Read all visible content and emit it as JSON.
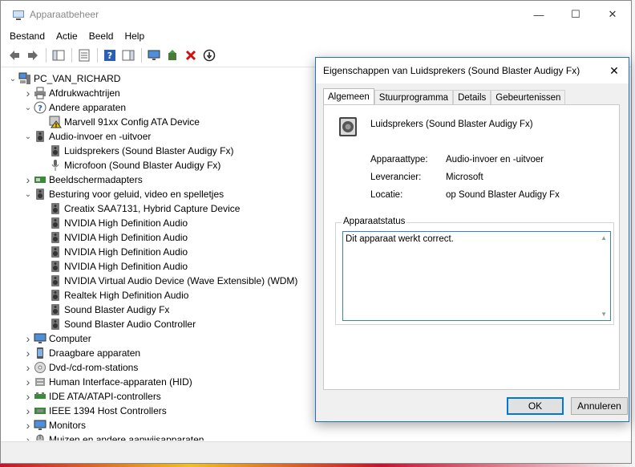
{
  "window": {
    "title": "Apparaatbeheer",
    "minimize_icon": "minimize-icon",
    "maximize_icon": "maximize-icon",
    "close_icon": "close-icon"
  },
  "menu": [
    "Bestand",
    "Actie",
    "Beeld",
    "Help"
  ],
  "toolbar": [
    "back-icon",
    "forward-icon",
    "show-hide-console-tree-icon",
    "properties-icon",
    "help-icon",
    "action-pane-icon",
    "monitor-icon",
    "update-driver-icon",
    "uninstall-icon",
    "disable-icon"
  ],
  "tree": [
    {
      "label": "PC_VAN_RICHARD",
      "level": 0,
      "expander": "expanded",
      "icon": "computer-icon"
    },
    {
      "label": "Afdrukwachtrijen",
      "level": 1,
      "expander": "collapsed",
      "icon": "printer-icon"
    },
    {
      "label": "Andere apparaten",
      "level": 1,
      "expander": "expanded",
      "icon": "unknown-device-icon"
    },
    {
      "label": "Marvell 91xx Config ATA Device",
      "level": 2,
      "expander": "none",
      "icon": "warning-device-icon"
    },
    {
      "label": "Audio-invoer en -uitvoer",
      "level": 1,
      "expander": "expanded",
      "icon": "speaker-icon"
    },
    {
      "label": "Luidsprekers (Sound Blaster Audigy Fx)",
      "level": 2,
      "expander": "none",
      "icon": "speaker-icon"
    },
    {
      "label": "Microfoon (Sound Blaster Audigy Fx)",
      "level": 2,
      "expander": "none",
      "icon": "microphone-icon"
    },
    {
      "label": "Beeldschermadapters",
      "level": 1,
      "expander": "collapsed",
      "icon": "display-adapter-icon"
    },
    {
      "label": "Besturing voor geluid, video en spelletjes",
      "level": 1,
      "expander": "expanded",
      "icon": "speaker-icon"
    },
    {
      "label": "Creatix SAA7131, Hybrid Capture Device",
      "level": 2,
      "expander": "none",
      "icon": "speaker-icon"
    },
    {
      "label": "NVIDIA High Definition Audio",
      "level": 2,
      "expander": "none",
      "icon": "speaker-icon"
    },
    {
      "label": "NVIDIA High Definition Audio",
      "level": 2,
      "expander": "none",
      "icon": "speaker-icon"
    },
    {
      "label": "NVIDIA High Definition Audio",
      "level": 2,
      "expander": "none",
      "icon": "speaker-icon"
    },
    {
      "label": "NVIDIA High Definition Audio",
      "level": 2,
      "expander": "none",
      "icon": "speaker-icon"
    },
    {
      "label": "NVIDIA Virtual Audio Device (Wave Extensible) (WDM)",
      "level": 2,
      "expander": "none",
      "icon": "speaker-icon"
    },
    {
      "label": "Realtek High Definition Audio",
      "level": 2,
      "expander": "none",
      "icon": "speaker-icon"
    },
    {
      "label": "Sound Blaster Audigy Fx",
      "level": 2,
      "expander": "none",
      "icon": "speaker-icon"
    },
    {
      "label": "Sound Blaster Audio Controller",
      "level": 2,
      "expander": "none",
      "icon": "speaker-icon"
    },
    {
      "label": "Computer",
      "level": 1,
      "expander": "collapsed",
      "icon": "monitor-icon"
    },
    {
      "label": "Draagbare apparaten",
      "level": 1,
      "expander": "collapsed",
      "icon": "portable-device-icon"
    },
    {
      "label": "Dvd-/cd-rom-stations",
      "level": 1,
      "expander": "collapsed",
      "icon": "disc-drive-icon"
    },
    {
      "label": "Human Interface-apparaten (HID)",
      "level": 1,
      "expander": "collapsed",
      "icon": "hid-icon"
    },
    {
      "label": "IDE ATA/ATAPI-controllers",
      "level": 1,
      "expander": "collapsed",
      "icon": "ide-controller-icon"
    },
    {
      "label": "IEEE 1394 Host Controllers",
      "level": 1,
      "expander": "collapsed",
      "icon": "ieee1394-icon"
    },
    {
      "label": "Monitors",
      "level": 1,
      "expander": "collapsed",
      "icon": "monitor-icon"
    },
    {
      "label": "Muizen en andere aanwijsapparaten",
      "level": 1,
      "expander": "collapsed",
      "icon": "mouse-icon"
    }
  ],
  "dialog": {
    "title": "Eigenschappen van Luidsprekers (Sound Blaster Audigy Fx)",
    "tabs": [
      "Algemeen",
      "Stuurprogramma",
      "Details",
      "Gebeurtenissen"
    ],
    "active_tab": "Algemeen",
    "device_name": "Luidsprekers (Sound Blaster Audigy Fx)",
    "properties": [
      {
        "label": "Apparaattype:",
        "value": "Audio-invoer en -uitvoer"
      },
      {
        "label": "Leverancier:",
        "value": "Microsoft"
      },
      {
        "label": "Locatie:",
        "value": "op Sound Blaster Audigy Fx"
      }
    ],
    "status_group_label": "Apparaatstatus",
    "status_text": "Dit apparaat werkt correct.",
    "ok_label": "OK",
    "cancel_label": "Annuleren"
  },
  "colors": {
    "accent": "#0078d7",
    "background": "#c8102e"
  }
}
